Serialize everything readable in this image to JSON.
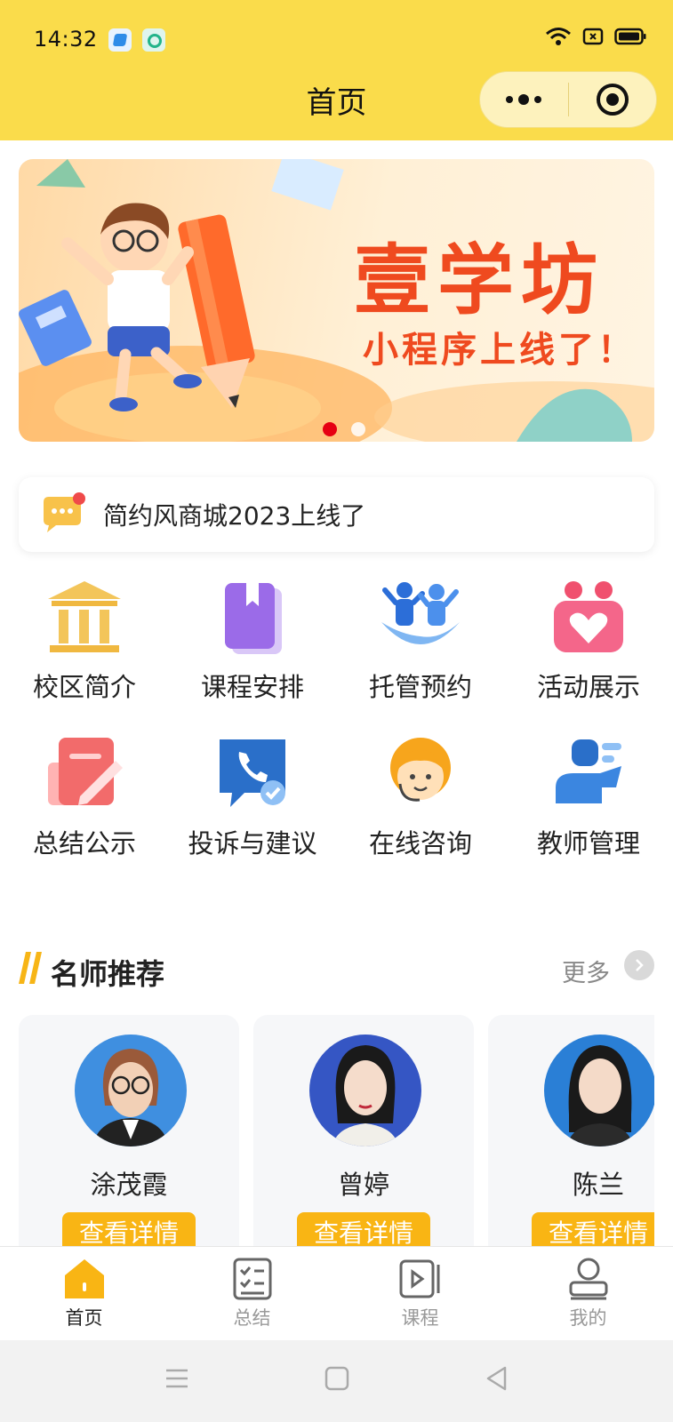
{
  "status_bar": {
    "time": "14:32"
  },
  "nav": {
    "title": "首页"
  },
  "banner": {
    "title": "壹学坊",
    "subtitle": "小程序上线了！",
    "slides": 2,
    "active_slide": 1,
    "accent_color": "#ef4a1f"
  },
  "notice": {
    "text": "简约风商城2023上线了"
  },
  "grid": [
    {
      "label": "校区简介",
      "icon": "campus-building-icon"
    },
    {
      "label": "课程安排",
      "icon": "course-book-icon"
    },
    {
      "label": "托管预约",
      "icon": "childcare-icon"
    },
    {
      "label": "活动展示",
      "icon": "activity-heart-icon"
    },
    {
      "label": "总结公示",
      "icon": "summary-edit-icon"
    },
    {
      "label": "投诉与建议",
      "icon": "complaint-phone-icon"
    },
    {
      "label": "在线咨询",
      "icon": "support-agent-icon"
    },
    {
      "label": "教师管理",
      "icon": "teacher-icon"
    }
  ],
  "teachers_section": {
    "title": "名师推荐",
    "more": "更多"
  },
  "teachers": [
    {
      "name": "涂茂霞",
      "button": "查看详情"
    },
    {
      "name": "曾婷",
      "button": "查看详情"
    },
    {
      "name": "陈兰",
      "button": "查看详情"
    }
  ],
  "tabbar": [
    {
      "label": "首页",
      "active": true
    },
    {
      "label": "总结",
      "active": false
    },
    {
      "label": "课程",
      "active": false
    },
    {
      "label": "我的",
      "active": false
    }
  ],
  "colors": {
    "header": "#fadc4b",
    "button": "#f9b514",
    "tab_active": "#f9b514"
  }
}
